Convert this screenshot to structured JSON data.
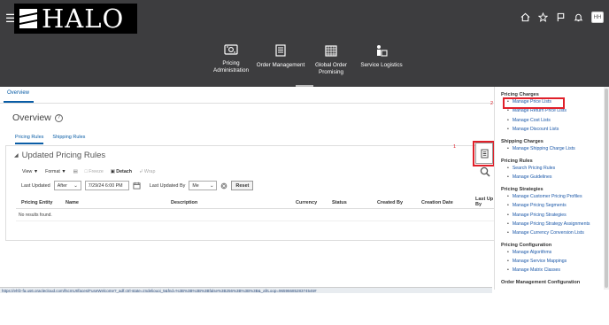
{
  "header": {
    "logo_text": "HALO",
    "avatar_initials": "HH",
    "nav": [
      {
        "label_lines": [
          "Pricing",
          "Administration"
        ],
        "icon": "pricing-admin-icon"
      },
      {
        "label_lines": [
          "Order Management"
        ],
        "icon": "order-management-icon"
      },
      {
        "label_lines": [
          "Global Order",
          "Promising"
        ],
        "icon": "global-order-promising-icon"
      },
      {
        "label_lines": [
          "Service Logistics"
        ],
        "icon": "service-logistics-icon"
      }
    ]
  },
  "main": {
    "tab_overview": "Overview",
    "page_title": "Overview",
    "subtabs": [
      "Pricing Rules",
      "Shipping Rules"
    ],
    "panel_title": "Updated Pricing Rules",
    "toolbar": {
      "view": "View",
      "format": "Format",
      "freeze": "Freeze",
      "detach": "Detach",
      "wrap": "Wrap"
    },
    "search": {
      "last_updated_label": "Last Updated",
      "operator": "After",
      "date": "7/29/24 6:00 PM",
      "last_updated_by_label": "Last Updated By",
      "by_value": "Me",
      "reset": "Reset"
    },
    "columns": [
      "Pricing Entity",
      "Name",
      "Description",
      "Currency",
      "Status",
      "Created By",
      "Creation Date"
    ],
    "last_updated_col": [
      "Last Up",
      "By"
    ],
    "no_results": "No results found."
  },
  "status_url": "https://ehfz-fa.us6.oraclecloud.com/fscmUI/faces/FuseWelcome?_adf.ctrl-state=zndeliouoi_5&fnd=%3B%3B%3B%3Bfalse%3B256%3B%3B%3B&_afrLoop=9659668528374546#",
  "annotations": {
    "mark1": "1",
    "mark2": "2"
  },
  "drawer": {
    "sections": [
      {
        "title": "Pricing Charges",
        "links": [
          "Manage Price Lists",
          "Manage Return Price Lists",
          "Manage Cost Lists",
          "Manage Discount Lists"
        ]
      },
      {
        "title": "Shipping Charges",
        "links": [
          "Manage Shipping Charge Lists"
        ]
      },
      {
        "title": "Pricing Rules",
        "links": [
          "Search Pricing Rules",
          "Manage Guidelines"
        ]
      },
      {
        "title": "Pricing Strategies",
        "links": [
          "Manage Customer Pricing Profiles",
          "Manage Pricing Segments",
          "Manage Pricing Strategies",
          "Manage Pricing Strategy Assignments",
          "Manage Currency Conversion Lists"
        ]
      },
      {
        "title": "Pricing Configuration",
        "links": [
          "Manage Algorithms",
          "Manage Service Mappings",
          "Manage Matrix Classes"
        ]
      },
      {
        "title": "Order Management Configuration",
        "links": []
      }
    ]
  },
  "colors": {
    "header_bg": "#3d3d3f",
    "link": "#1a57a8",
    "annotation_red": "#e0202a"
  }
}
